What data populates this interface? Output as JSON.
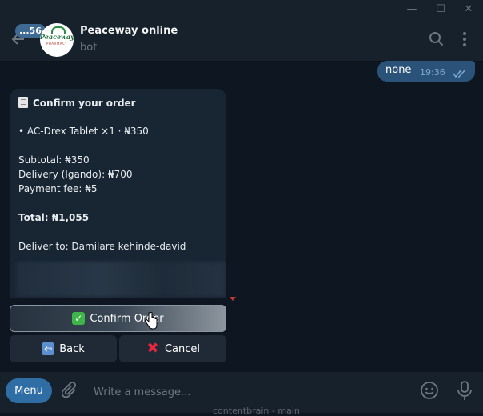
{
  "window": {
    "minimize": "—",
    "maximize": "☐",
    "close": "✕"
  },
  "header": {
    "unread_badge": "56",
    "unread_prefix": "...",
    "title": "Peaceway online",
    "subtitle": "bot",
    "avatar_brand": "Peaceway",
    "avatar_tagline": "PHARMACY"
  },
  "outgoing": {
    "text": "none",
    "time": "19:36"
  },
  "order": {
    "heading": "Confirm your order",
    "item": "• AC-Drex Tablet ×1 · ₦350",
    "subtotal": "Subtotal: ₦350",
    "delivery": "Delivery (Igando): ₦700",
    "payment_fee": "Payment fee: ₦5",
    "total": "Total: ₦1,055",
    "deliver_to": "Deliver to: Damilare kehinde-david"
  },
  "buttons": {
    "confirm": "Confirm Order",
    "back": "Back",
    "cancel": "Cancel"
  },
  "composer": {
    "menu": "Menu",
    "placeholder": "Write a message...",
    "under_text": "contentbrain - main"
  },
  "colors": {
    "bg": "#0e1621",
    "header": "#17212b",
    "out_bubble": "#2b5278",
    "in_bubble": "#182533",
    "menu": "#2f6ea5"
  }
}
